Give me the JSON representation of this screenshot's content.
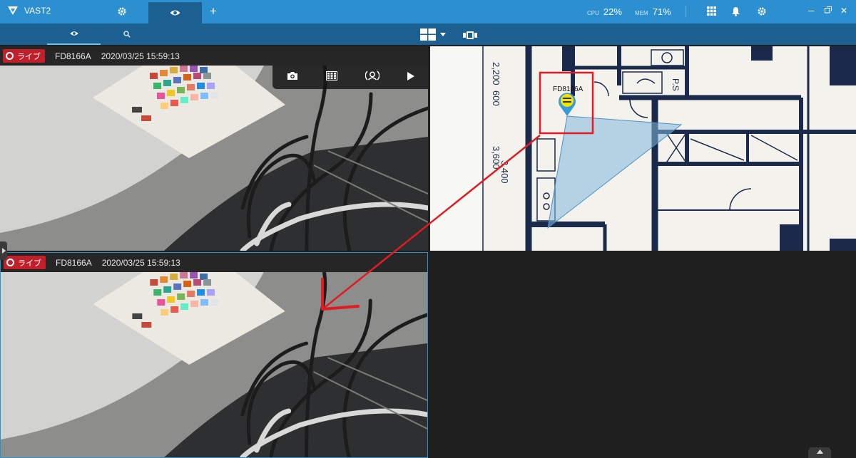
{
  "app": {
    "title": "VAST2"
  },
  "system": {
    "cpu_label": "CPU",
    "cpu_value": "22%",
    "mem_label": "MEM",
    "mem_value": "71%"
  },
  "cameras": [
    {
      "badge": "ライブ",
      "name": "FD8166A",
      "timestamp": "2020/03/25 15:59:13"
    },
    {
      "badge": "ライブ",
      "name": "FD8166A",
      "timestamp": "2020/03/25 15:59:13"
    }
  ],
  "map": {
    "camera_label": "FD8166A",
    "dimensions": [
      "2,200",
      "600",
      "3,600",
      "3,400",
      "P.S"
    ]
  },
  "colors": {
    "accent": "#2b8fd0",
    "nav_dark": "#1c5f91",
    "live_red": "#c0202a",
    "annotation_red": "#e01b24",
    "fov_blue": "#7fb8dc",
    "marker_yellow": "#f3e500"
  },
  "icons": [
    "logo-icon",
    "gear-icon",
    "eye-icon",
    "plus-icon",
    "grid-icon",
    "bell-icon",
    "minimize-icon",
    "restore-icon",
    "close-icon",
    "search-icon",
    "layout-icon",
    "sequence-icon",
    "camera-snapshot-icon",
    "fisheye-grid-icon",
    "ptz-icon",
    "play-icon"
  ]
}
